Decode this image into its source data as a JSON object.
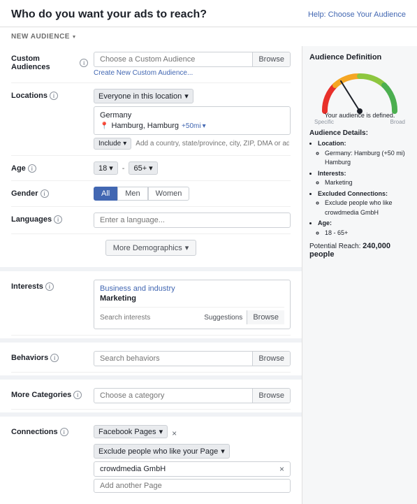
{
  "header": {
    "title": "Who do you want your ads to reach?",
    "help_text": "Help: Choose Your Audience"
  },
  "new_audience": {
    "label": "NEW AUDIENCE",
    "arrow": "▾"
  },
  "form": {
    "custom_audiences": {
      "label": "Custom Audiences",
      "placeholder": "Choose a Custom Audience",
      "browse": "Browse",
      "create_link": "Create New Custom Audience..."
    },
    "locations": {
      "label": "Locations",
      "dropdown_text": "Everyone in this location",
      "country": "Germany",
      "city": "Hamburg, Hamburg",
      "radius": "+50mi",
      "include_text": "Include",
      "address_placeholder": "Add a country, state/province, city, ZIP, DMA or address"
    },
    "age": {
      "label": "Age",
      "min": "18",
      "max": "65+",
      "dash": "-"
    },
    "gender": {
      "label": "Gender",
      "options": [
        "All",
        "Men",
        "Women"
      ],
      "active": "All"
    },
    "languages": {
      "label": "Languages",
      "placeholder": "Enter a language..."
    },
    "more_demographics": {
      "label": "More Demographics",
      "arrow": "▾"
    },
    "interests": {
      "label": "Interests",
      "category": "Business and industry",
      "tag": "Marketing",
      "search_placeholder": "Search interests",
      "suggestions": "Suggestions",
      "browse": "Browse"
    },
    "behaviors": {
      "label": "Behaviors",
      "placeholder": "Search behaviors",
      "browse": "Browse"
    },
    "more_categories": {
      "label": "More Categories",
      "placeholder": "Choose a category",
      "browse": "Browse"
    },
    "connections": {
      "label": "Connections",
      "pages_label": "Facebook Pages",
      "exclude_label": "Exclude people who like your Page",
      "page_name": "crowdmedia GmbH",
      "add_placeholder": "Add another Page"
    }
  },
  "audience_definition": {
    "title": "Audience Definition",
    "gauge_label": "Your audience is defined.",
    "axis_left": "Specific",
    "axis_right": "Broad",
    "details_title": "Audience Details:",
    "details": {
      "location_label": "Location:",
      "location_value": "Germany: Hamburg (+50 mi) Hamburg",
      "interests_label": "Interests:",
      "interests_value": "Marketing",
      "excluded_label": "Excluded Connections:",
      "excluded_value": "Exclude people who like crowdmedia GmbH",
      "age_label": "Age:",
      "age_value": "18 - 65+"
    },
    "potential_reach_label": "Potential Reach:",
    "potential_reach_value": "240,000 people"
  }
}
